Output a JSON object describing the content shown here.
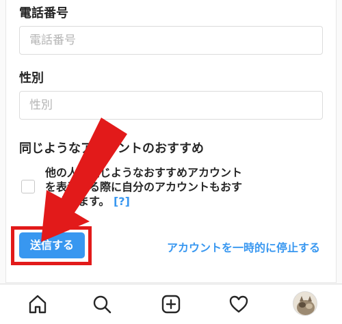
{
  "form": {
    "phone": {
      "label": "電話番号",
      "placeholder": "電話番号",
      "value": ""
    },
    "gender": {
      "label": "性別",
      "placeholder": "性別",
      "value": ""
    },
    "recommendations": {
      "heading": "同じようなアカウントのおすすめ",
      "description_line1": "他の人に同じようなおすすめアカウント",
      "description_line2": "を表示する際に自分のアカウントもおす",
      "description_line3": "すめします。",
      "help_link": "[?]",
      "checked": false
    },
    "submit_label": "送信する",
    "deactivate_link": "アカウントを一時的に停止する"
  },
  "bottom_nav": {
    "items": [
      {
        "name": "home",
        "icon": "home-icon"
      },
      {
        "name": "search",
        "icon": "search-icon"
      },
      {
        "name": "new-post",
        "icon": "plus-square-icon"
      },
      {
        "name": "activity",
        "icon": "heart-icon"
      },
      {
        "name": "profile",
        "icon": "avatar"
      }
    ]
  },
  "colors": {
    "accent": "#3897f0",
    "annotation": "#e21a1a",
    "text": "#262626",
    "border": "#dbdbdb"
  }
}
